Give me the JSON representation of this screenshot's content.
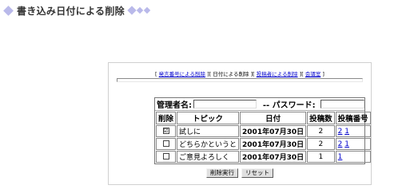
{
  "header": {
    "title": "書き込み日付による削除"
  },
  "nav": {
    "bracket_open": "[",
    "bracket_close": "]",
    "separator": "][",
    "items": [
      {
        "label": "発言番号による削除",
        "link": true
      },
      {
        "label": "日付による削除",
        "link": false
      },
      {
        "label": "投稿者による削除",
        "link": true
      },
      {
        "label": "会議室",
        "link": true
      }
    ]
  },
  "login": {
    "admin_label": "管理者名:",
    "admin_value": "",
    "password_label": "-- パスワード:",
    "password_value": ""
  },
  "table": {
    "headers": [
      "削除",
      "トピック",
      "日付",
      "投稿数",
      "投稿番号"
    ],
    "rows": [
      {
        "checked": true,
        "mark": "☑",
        "topic": "試しに",
        "date": "2001年07月30日",
        "count": "2",
        "numbers": [
          "2",
          "1"
        ]
      },
      {
        "checked": false,
        "mark": "",
        "topic": "どちらかというと",
        "date": "2001年07月30日",
        "count": "2",
        "numbers": [
          "2",
          "1"
        ]
      },
      {
        "checked": false,
        "mark": "",
        "topic": "ご意見よろしく",
        "date": "2001年07月30日",
        "count": "1",
        "numbers": [
          "1"
        ]
      }
    ]
  },
  "buttons": {
    "submit": "削除実行",
    "reset": "リセット"
  },
  "colors": {
    "accent": "#b9b9ea",
    "link": "#0000cc",
    "title": "#333333",
    "border": "#d0d0d0"
  }
}
